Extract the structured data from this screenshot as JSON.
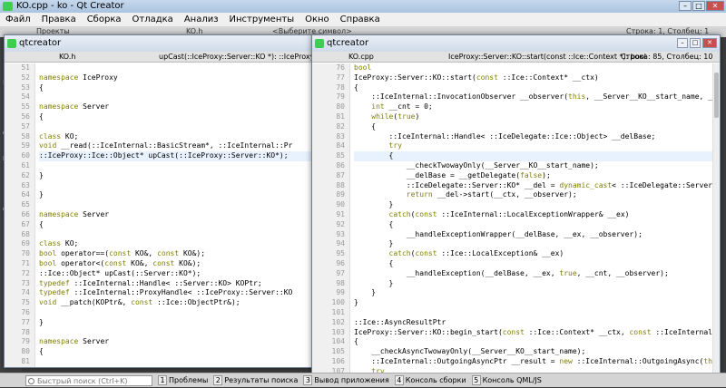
{
  "app": {
    "title": "KO.cpp - ko - Qt Creator"
  },
  "menu": [
    "Файл",
    "Правка",
    "Сборка",
    "Отладка",
    "Анализ",
    "Инструменты",
    "Окно",
    "Справка"
  ],
  "toolbar": {
    "projects_label": "Проекты",
    "file_label": "KO.h",
    "symbol_placeholder": "<Выберите символ>",
    "position_label": "Строка: 1, Столбец: 1"
  },
  "sidebar_modes": [
    "Нач",
    "Реда",
    "Диз",
    "Отла",
    "Прое",
    "Ана",
    "Спра"
  ],
  "left_window": {
    "title": "qtcreator",
    "file": "KO.h",
    "symbol": "upCast(::IceProxy::Server::KO *): ::IceProxy::Ice::Object*",
    "first_line": 51,
    "lines": [
      "",
      "namespace IceProxy",
      "{",
      "",
      "namespace Server",
      "{",
      "",
      "class KO;",
      "void __read(::IceInternal::BasicStream*, ::IceInternal::Pr",
      "::IceProxy::Ice::Object* upCast(::IceProxy::Server::KO*);",
      "",
      "}",
      "",
      "}",
      "",
      "namespace Server",
      "{",
      "",
      "class KO;",
      "bool operator==(const KO&, const KO&);",
      "bool operator<(const KO&, const KO&);",
      "::Ice::Object* upCast(::Server::KO*);",
      "typedef ::IceInternal::Handle< ::Server::KO> KOPtr;",
      "typedef ::IceInternal::ProxyHandle< ::IceProxy::Server::KO",
      "void __patch(KOPtr&, const ::Ice::ObjectPtr&);",
      "",
      "}",
      "",
      "namespace Server",
      "{",
      "",
      "enum STATUS",
      "{",
      "    STOPPED,",
      "    ERR,"
    ]
  },
  "right_window": {
    "title": "qtcreator",
    "file": "KO.cpp",
    "symbol": "IceProxy::Server::KO::start(const ::Ice::Context *): bool",
    "position": "Строка: 85, Столбец: 10",
    "first_line": 76,
    "lines": [
      "bool",
      "IceProxy::Server::KO::start(const ::Ice::Context* __ctx)",
      "{",
      "    ::IceInternal::InvocationObserver __observer(this, __Server__KO__start_name, __c",
      "    int __cnt = 0;",
      "    while(true)",
      "    {",
      "        ::IceInternal::Handle< ::IceDelegate::Ice::Object> __delBase;",
      "        try",
      "        {",
      "            __checkTwowayOnly(__Server__KO__start_name);",
      "            __delBase = __getDelegate(false);",
      "            ::IceDelegate::Server::KO* __del = dynamic_cast< ::IceDelegate::Server::",
      "            return __del->start(__ctx, __observer);",
      "        }",
      "        catch(const ::IceInternal::LocalExceptionWrapper& __ex)",
      "        {",
      "            __handleExceptionWrapper(__delBase, __ex, __observer);",
      "        }",
      "        catch(const ::Ice::LocalException& __ex)",
      "        {",
      "            __handleException(__delBase, __ex, true, __cnt, __observer);",
      "        }",
      "    }",
      "}",
      "",
      "::Ice::AsyncResultPtr",
      "IceProxy::Server::KO::begin_start(const ::Ice::Context* __ctx, const ::IceInternal::",
      "{",
      "    __checkAsyncTwowayOnly(__Server__KO__start_name);",
      "    ::IceInternal::OutgoingAsyncPtr __result = new ::IceInternal::OutgoingAsync(this",
      "    try",
      "    {",
      "        __result->__prepare(__Server__KO__start_name, ::Ice::Normal, __ctx);",
      "        __result->__writeEmptyParams();"
    ]
  },
  "status": {
    "search_placeholder": "Быстрый поиск (Ctrl+K)",
    "panes": [
      {
        "num": "1",
        "label": "Проблемы"
      },
      {
        "num": "2",
        "label": "Результаты поиска"
      },
      {
        "num": "3",
        "label": "Вывод приложения"
      },
      {
        "num": "4",
        "label": "Консоль сборки"
      },
      {
        "num": "5",
        "label": "Консоль QML/JS"
      }
    ]
  }
}
